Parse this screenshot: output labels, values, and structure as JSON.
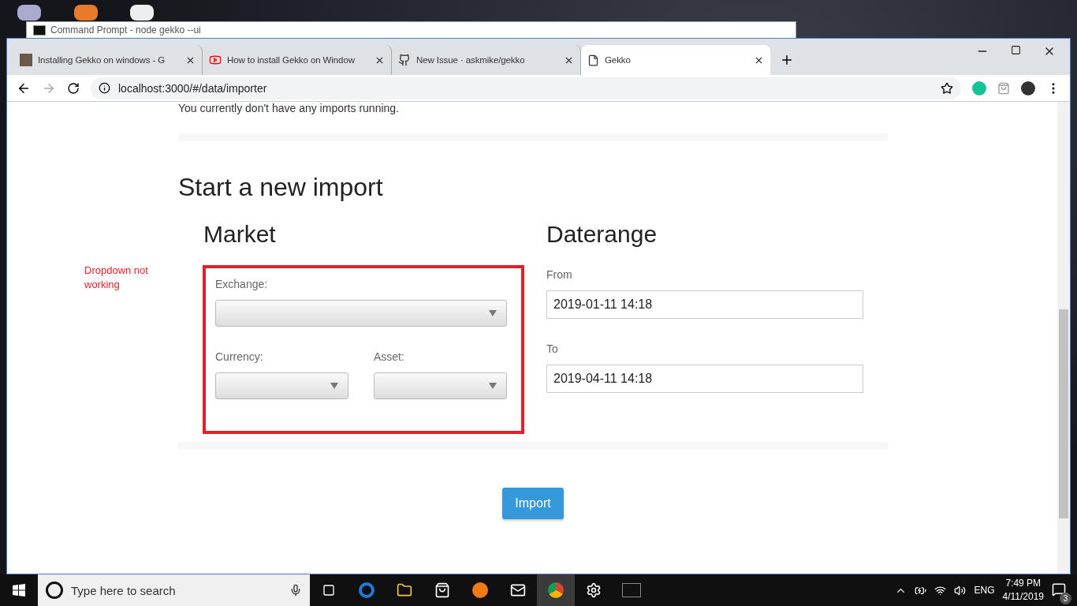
{
  "command_prompt": {
    "title": "Command Prompt - node  gekko --ui"
  },
  "browser": {
    "tabs": [
      {
        "title": "Installing Gekko on windows - G",
        "kind": "avatar",
        "selected": false
      },
      {
        "title": "How to install Gekko on Window",
        "kind": "video",
        "selected": false
      },
      {
        "title": "New Issue · askmike/gekko",
        "kind": "github",
        "selected": false
      },
      {
        "title": "Gekko",
        "kind": "page",
        "selected": true
      }
    ],
    "address": "localhost:3000/#/data/importer"
  },
  "page": {
    "status_text": "You currently don't have any imports running.",
    "heading": "Start a new import",
    "annotation": "Dropdown not working",
    "market": {
      "title": "Market",
      "exchange_label": "Exchange:",
      "currency_label": "Currency:",
      "asset_label": "Asset:"
    },
    "daterange": {
      "title": "Daterange",
      "from_label": "From",
      "from_value": "2019-01-11 14:18",
      "to_label": "To",
      "to_value": "2019-04-11 14:18"
    },
    "import_button": "Import"
  },
  "taskbar": {
    "search_placeholder": "Type here to search",
    "language": "ENG",
    "time": "7:49 PM",
    "date": "4/11/2019",
    "notifications": "3"
  }
}
